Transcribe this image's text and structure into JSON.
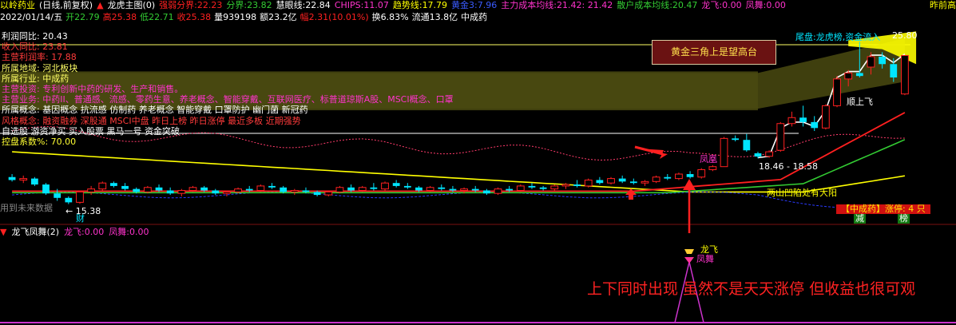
{
  "header": {
    "stock_name": "以岭药业",
    "period": "(日线,前复权)",
    "indicator_name": "龙虎主图(0)",
    "qiangruo_label": "强弱分界:",
    "qiangruo_value": "22.23",
    "fenjie_label": "分界:",
    "fenjie_value": "23.82",
    "huiyan_label": "慧眼线:",
    "huiyan_value": "22.84",
    "chips_label": "CHIPS:",
    "chips_value": "11.07",
    "qushi_label": "趋势线:",
    "qushi_value": "17.79",
    "huangjin_label": "黄金3:",
    "huangjin_value": "7.96",
    "zhuli_label": "主力成本均线:",
    "zhuli_value": "21.42",
    "zhuli_value2": ": 21.42",
    "sanhu_label": "散户成本均线:",
    "sanhu_value": "20.47",
    "longfei_label": "龙飞:",
    "longfei_value": "0.00",
    "fengwu_label": "凤舞:",
    "fengwu_value": "0.00",
    "corner_label": "昨前高"
  },
  "quote": {
    "date": "2022/01/14/五",
    "open_label": "开",
    "open": "22.79",
    "high_label": "高",
    "high": "25.38",
    "low_label": "低",
    "low": "22.71",
    "close_label": "收",
    "close": "25.38",
    "vol_label": "量",
    "volume": "939198",
    "amt_label": "额",
    "amount": "23.2亿",
    "chg_label": "幅",
    "change": "2.31(10.01%)",
    "turn_label": "换",
    "turnover": "6.83%",
    "float_label": "流通",
    "float_cap": "13.8亿",
    "sector": "中成药"
  },
  "info_lines": [
    {
      "text": "利润同比:  20.43",
      "color": "#ffffff"
    },
    {
      "text": "收入同比:  23.81",
      "color": "#ff3b3b"
    },
    {
      "text": "主营利润率:  17.88",
      "color": "#ff3b3b"
    },
    {
      "text": "所属地域:  河北板块",
      "color": "#ffff66"
    },
    {
      "text": "所属行业:  中成药",
      "color": "#ffff66"
    },
    {
      "text": "主营投资:  专利创新中药的研发、生产和销售。",
      "color": "#ff33cc"
    },
    {
      "text": "主营业务:  中药II、普通感、流感、零药生意、养老概念、智能穿戴、互联网医疗、标普道琼斯A股、MSCI概念、口罩",
      "color": "#ff33cc"
    },
    {
      "text": "所属概念:  基因概念 抗流感 仿制药 养老概念 智能穿戴 口罩防护 幽门菌 新冠药",
      "color": "#ffffff"
    },
    {
      "text": "风格概念:  融资融券 深股通 MSCI中盘 昨日上榜 昨日涨停 最近多板 近期强势",
      "color": "#ff3b3b"
    },
    {
      "text": "自选股  游资净买  买入股票  黑马一号  资金突破",
      "color": "#ffffff"
    },
    {
      "text": "控盘系数%:  70.00",
      "color": "#ffff33"
    }
  ],
  "annotations": {
    "gold_box": "黄金三角上是望高台",
    "weipan": "尾盘:龙虎榜,资金流入",
    "weipan_value": "25.80",
    "shunshang": "顺上飞",
    "fenghuang": "凤凰",
    "liangliang": "两山凹陷处有大阳",
    "weilai": "用到未来数据",
    "cai": "财",
    "low_price": "← 15.38",
    "range_label": "18.46 - 18.58",
    "zhongchengyao_badge": "【中成药】涨停: 4 只",
    "jian": "减",
    "bang": "榜"
  },
  "sub_indicator": {
    "name": "龙飞凤舞(2)",
    "longfei_label": "龙飞:",
    "longfei_value": "0.00",
    "fengwu_label": "凤舞:",
    "fengwu_value": "0.00",
    "icon_label_1": "龙飞",
    "icon_label_2": "凤舞",
    "caption": "上下同时出现 虽然不是天天涨停 但收益也很可观"
  },
  "colors": {
    "up": "#ff2020",
    "down": "#00e5ff",
    "ma_red": "#ff2020",
    "ma_green": "#33cc33",
    "ma_yellow": "#ffff00",
    "ma_white": "#ffffff",
    "band_fill": "#4a4a10",
    "blue_line": "#2a3aff",
    "magenta": "#ff33cc"
  },
  "chart_data": {
    "type": "candlestick",
    "title": "以岭药业 (日线,前复权)",
    "last_date": "2022/01/14",
    "price_range": [
      14.5,
      27.5
    ],
    "candles": [
      {
        "o": 17.2,
        "h": 17.4,
        "l": 16.9,
        "c": 17.0
      },
      {
        "o": 17.0,
        "h": 17.3,
        "l": 16.8,
        "c": 17.1
      },
      {
        "o": 17.1,
        "h": 17.2,
        "l": 16.6,
        "c": 16.7
      },
      {
        "o": 16.7,
        "h": 16.8,
        "l": 16.0,
        "c": 16.1
      },
      {
        "o": 16.1,
        "h": 16.4,
        "l": 15.6,
        "c": 15.8
      },
      {
        "o": 15.8,
        "h": 15.9,
        "l": 15.38,
        "c": 15.5
      },
      {
        "o": 15.5,
        "h": 16.3,
        "l": 15.4,
        "c": 16.2
      },
      {
        "o": 16.2,
        "h": 16.6,
        "l": 16.0,
        "c": 16.4
      },
      {
        "o": 16.4,
        "h": 16.9,
        "l": 16.3,
        "c": 16.8
      },
      {
        "o": 16.8,
        "h": 16.9,
        "l": 16.5,
        "c": 16.6
      },
      {
        "o": 16.6,
        "h": 16.8,
        "l": 16.3,
        "c": 16.4
      },
      {
        "o": 16.4,
        "h": 16.5,
        "l": 16.1,
        "c": 16.2
      },
      {
        "o": 16.2,
        "h": 16.6,
        "l": 16.1,
        "c": 16.5
      },
      {
        "o": 16.5,
        "h": 16.7,
        "l": 16.2,
        "c": 16.3
      },
      {
        "o": 16.3,
        "h": 16.5,
        "l": 16.0,
        "c": 16.1
      },
      {
        "o": 16.1,
        "h": 16.4,
        "l": 15.9,
        "c": 16.3
      },
      {
        "o": 16.3,
        "h": 16.6,
        "l": 16.2,
        "c": 16.5
      },
      {
        "o": 16.5,
        "h": 16.6,
        "l": 16.2,
        "c": 16.3
      },
      {
        "o": 16.3,
        "h": 16.4,
        "l": 16.0,
        "c": 16.1
      },
      {
        "o": 16.1,
        "h": 16.3,
        "l": 15.9,
        "c": 16.2
      },
      {
        "o": 16.2,
        "h": 16.5,
        "l": 16.1,
        "c": 16.4
      },
      {
        "o": 16.4,
        "h": 16.6,
        "l": 16.2,
        "c": 16.3
      },
      {
        "o": 16.3,
        "h": 16.7,
        "l": 16.2,
        "c": 16.6
      },
      {
        "o": 16.6,
        "h": 16.8,
        "l": 16.4,
        "c": 16.5
      },
      {
        "o": 16.5,
        "h": 16.6,
        "l": 16.1,
        "c": 16.2
      },
      {
        "o": 16.2,
        "h": 16.4,
        "l": 16.0,
        "c": 16.3
      },
      {
        "o": 16.3,
        "h": 16.5,
        "l": 16.1,
        "c": 16.2
      },
      {
        "o": 16.2,
        "h": 16.3,
        "l": 15.9,
        "c": 16.0
      },
      {
        "o": 16.0,
        "h": 16.3,
        "l": 15.9,
        "c": 16.2
      },
      {
        "o": 16.2,
        "h": 16.6,
        "l": 16.1,
        "c": 16.5
      },
      {
        "o": 16.5,
        "h": 16.7,
        "l": 16.2,
        "c": 16.3
      },
      {
        "o": 16.3,
        "h": 16.6,
        "l": 16.2,
        "c": 16.5
      },
      {
        "o": 16.5,
        "h": 16.8,
        "l": 16.3,
        "c": 16.4
      },
      {
        "o": 16.4,
        "h": 16.9,
        "l": 16.3,
        "c": 16.8
      },
      {
        "o": 16.8,
        "h": 17.0,
        "l": 16.5,
        "c": 16.6
      },
      {
        "o": 16.6,
        "h": 16.8,
        "l": 16.4,
        "c": 16.5
      },
      {
        "o": 16.5,
        "h": 16.6,
        "l": 16.2,
        "c": 16.3
      },
      {
        "o": 16.3,
        "h": 16.6,
        "l": 16.2,
        "c": 16.5
      },
      {
        "o": 16.5,
        "h": 16.7,
        "l": 16.3,
        "c": 16.4
      },
      {
        "o": 16.4,
        "h": 16.6,
        "l": 16.2,
        "c": 16.3
      },
      {
        "o": 16.3,
        "h": 16.5,
        "l": 16.1,
        "c": 16.4
      },
      {
        "o": 16.4,
        "h": 16.6,
        "l": 16.2,
        "c": 16.3
      },
      {
        "o": 16.3,
        "h": 16.4,
        "l": 16.0,
        "c": 16.1
      },
      {
        "o": 16.1,
        "h": 16.5,
        "l": 16.0,
        "c": 16.4
      },
      {
        "o": 16.4,
        "h": 16.6,
        "l": 16.2,
        "c": 16.3
      },
      {
        "o": 16.3,
        "h": 16.7,
        "l": 16.2,
        "c": 16.6
      },
      {
        "o": 16.6,
        "h": 16.8,
        "l": 16.4,
        "c": 16.5
      },
      {
        "o": 16.5,
        "h": 16.6,
        "l": 16.3,
        "c": 16.4
      },
      {
        "o": 16.4,
        "h": 16.7,
        "l": 16.3,
        "c": 16.6
      },
      {
        "o": 16.6,
        "h": 16.8,
        "l": 16.4,
        "c": 16.7
      },
      {
        "o": 16.7,
        "h": 17.0,
        "l": 16.5,
        "c": 16.6
      },
      {
        "o": 16.6,
        "h": 17.1,
        "l": 16.5,
        "c": 17.0
      },
      {
        "o": 17.0,
        "h": 17.2,
        "l": 16.7,
        "c": 16.8
      },
      {
        "o": 16.8,
        "h": 17.2,
        "l": 16.7,
        "c": 17.1
      },
      {
        "o": 17.1,
        "h": 17.3,
        "l": 16.8,
        "c": 16.9
      },
      {
        "o": 16.9,
        "h": 17.1,
        "l": 16.7,
        "c": 16.8
      },
      {
        "o": 16.8,
        "h": 17.0,
        "l": 16.6,
        "c": 16.9
      },
      {
        "o": 16.9,
        "h": 17.3,
        "l": 16.8,
        "c": 17.2
      },
      {
        "o": 17.2,
        "h": 17.4,
        "l": 17.0,
        "c": 17.1
      },
      {
        "o": 17.1,
        "h": 17.5,
        "l": 17.0,
        "c": 17.4
      },
      {
        "o": 17.4,
        "h": 17.6,
        "l": 17.1,
        "c": 17.2
      },
      {
        "o": 17.2,
        "h": 17.8,
        "l": 17.1,
        "c": 17.7
      },
      {
        "o": 17.7,
        "h": 18.0,
        "l": 17.6,
        "c": 17.9
      },
      {
        "o": 17.9,
        "h": 19.9,
        "l": 17.9,
        "c": 19.8
      },
      {
        "o": 19.8,
        "h": 20.0,
        "l": 19.6,
        "c": 19.7
      },
      {
        "o": 19.7,
        "h": 20.1,
        "l": 18.9,
        "c": 19.0
      },
      {
        "o": 18.8,
        "h": 18.9,
        "l": 18.46,
        "c": 18.58
      },
      {
        "o": 18.6,
        "h": 19.0,
        "l": 18.5,
        "c": 18.9
      },
      {
        "o": 19.0,
        "h": 20.9,
        "l": 18.9,
        "c": 20.8
      },
      {
        "o": 20.8,
        "h": 21.6,
        "l": 20.6,
        "c": 21.2
      },
      {
        "o": 21.2,
        "h": 22.0,
        "l": 20.6,
        "c": 20.9
      },
      {
        "o": 20.9,
        "h": 21.3,
        "l": 20.3,
        "c": 20.5
      },
      {
        "o": 20.5,
        "h": 22.1,
        "l": 20.4,
        "c": 22.0
      },
      {
        "o": 22.0,
        "h": 24.0,
        "l": 21.9,
        "c": 23.8
      },
      {
        "o": 23.8,
        "h": 24.4,
        "l": 23.3,
        "c": 24.2
      },
      {
        "o": 24.2,
        "h": 26.3,
        "l": 23.9,
        "c": 24.0
      },
      {
        "o": 24.6,
        "h": 25.6,
        "l": 24.1,
        "c": 25.3
      },
      {
        "o": 25.3,
        "h": 25.6,
        "l": 24.5,
        "c": 24.8
      },
      {
        "o": 24.8,
        "h": 25.2,
        "l": 23.6,
        "c": 23.9
      },
      {
        "o": 22.79,
        "h": 25.38,
        "l": 22.71,
        "c": 25.38
      }
    ],
    "subplot": {
      "name": "龙飞凤舞(2)",
      "series": [
        {
          "name": "龙飞",
          "values_nonzero_index": [
            76
          ],
          "value": 1
        }
      ]
    }
  }
}
